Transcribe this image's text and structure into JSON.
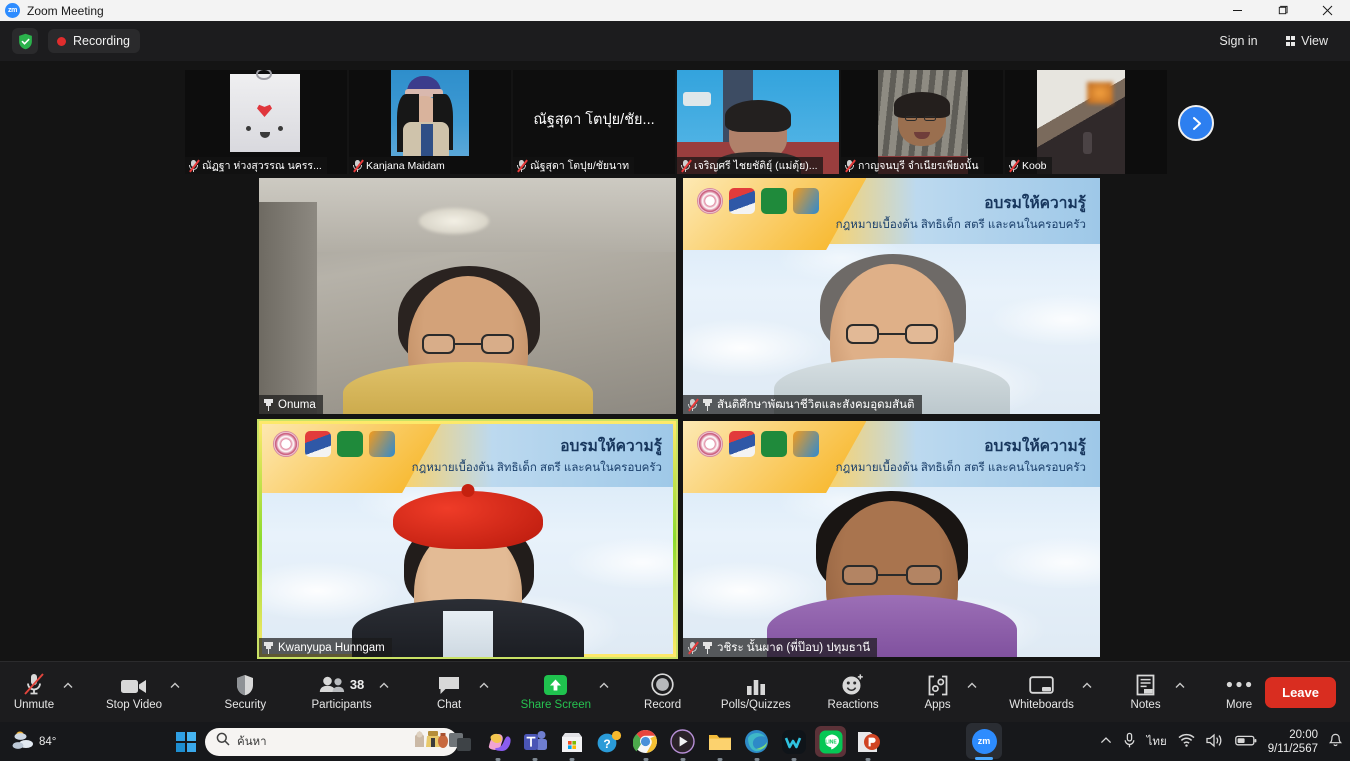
{
  "window": {
    "title": "Zoom Meeting",
    "app_icon": "zoom-logo-icon",
    "minimize_label": "Minimize",
    "maximize_label": "Restore",
    "close_label": "Close"
  },
  "topbar": {
    "encryption_icon": "shield-check-icon",
    "recording_label": "Recording",
    "recording_dot_color": "#e02d2d",
    "sign_in_label": "Sign in",
    "view_label": "View",
    "view_icon": "grid-view-icon"
  },
  "filmstrip": {
    "next_page_icon": "chevron-right-icon",
    "tiles": [
      {
        "name": "ณัฏฐา ห่วงสุวรรณ นครร...",
        "muted": true,
        "kind": "photo-avatar"
      },
      {
        "name": "Kanjana Maidam",
        "muted": true,
        "kind": "photo-avatar"
      },
      {
        "name": "ณัฐสุดา โตปุย/ชัยนาท",
        "muted": true,
        "kind": "name-only",
        "big_name": "ณัฐสุดา  โตปุย/ชัย..."
      },
      {
        "name": "เจริญศรี ไชยชัติยุ์ (แม่ตุ้ย)...",
        "muted": true,
        "kind": "video"
      },
      {
        "name": "กาญจนบุรี จำเนียรเพียงนั้น",
        "muted": true,
        "kind": "video"
      },
      {
        "name": "Koob",
        "muted": true,
        "kind": "video"
      }
    ]
  },
  "gallery": {
    "virtual_bg": {
      "heading": "อบรมให้ความรู้",
      "subheading": "กฎหมายเบื้องต้น สิทธิเด็ก สตรี และคนในครอบครัว"
    },
    "tiles": [
      {
        "name": "Onuma",
        "pinned": true,
        "muted": false,
        "active_speaker": false,
        "background": "room"
      },
      {
        "name": "สันติศึกษาพัฒนาชีวิตและสังคมอุดมสันติ",
        "pinned": true,
        "muted": true,
        "active_speaker": false,
        "background": "virtual"
      },
      {
        "name": "Kwanyupa Hunngam",
        "pinned": true,
        "muted": false,
        "active_speaker": true,
        "background": "virtual"
      },
      {
        "name": "วชิระ นั้นผาด (พี่ป๊อบ) ปทุมธานี",
        "pinned": true,
        "muted": true,
        "active_speaker": false,
        "background": "virtual"
      }
    ]
  },
  "controls": {
    "items": [
      {
        "label": "Unmute",
        "icon": "microphone-muted-icon",
        "caret": true,
        "accent": ""
      },
      {
        "label": "Stop Video",
        "icon": "video-camera-icon",
        "caret": true,
        "accent": ""
      },
      {
        "label": "Security",
        "icon": "shield-icon",
        "caret": false,
        "accent": ""
      },
      {
        "label": "Participants",
        "icon": "people-icon",
        "caret": true,
        "accent": "",
        "count": "38"
      },
      {
        "label": "Chat",
        "icon": "chat-bubble-icon",
        "caret": true,
        "accent": ""
      },
      {
        "label": "Share Screen",
        "icon": "share-screen-up-arrow-icon",
        "caret": true,
        "accent": "#26c250"
      },
      {
        "label": "Record",
        "icon": "record-circle-icon",
        "caret": false,
        "accent": ""
      },
      {
        "label": "Polls/Quizzes",
        "icon": "bar-chart-icon",
        "caret": false,
        "accent": ""
      },
      {
        "label": "Reactions",
        "icon": "smiley-plus-icon",
        "caret": false,
        "accent": ""
      },
      {
        "label": "Apps",
        "icon": "apps-bracket-icon",
        "caret": true,
        "accent": ""
      },
      {
        "label": "Whiteboards",
        "icon": "whiteboard-icon",
        "caret": true,
        "accent": ""
      },
      {
        "label": "Notes",
        "icon": "notes-icon",
        "caret": true,
        "accent": ""
      },
      {
        "label": "More",
        "icon": "ellipsis-icon",
        "caret": false,
        "accent": ""
      }
    ],
    "leave_label": "Leave",
    "leave_color": "#d92d20"
  },
  "taskbar": {
    "weather_temp": "84°",
    "weather_icon": "partly-cloudy-icon",
    "start_icon": "windows-logo-icon",
    "search_placeholder": "ค้นหา",
    "search_icon": "search-icon",
    "search_trailing_icon": "museum-artifacts-icon",
    "apps": [
      {
        "name": "task-view-icon",
        "glyph": ""
      },
      {
        "name": "copilot-icon",
        "glyph": ""
      },
      {
        "name": "microsoft-teams-icon",
        "glyph": "T"
      },
      {
        "name": "microsoft-store-icon",
        "glyph": ""
      },
      {
        "name": "get-help-icon",
        "glyph": "?"
      },
      {
        "name": "google-chrome-icon",
        "glyph": ""
      },
      {
        "name": "media-player-icon",
        "glyph": "▶"
      },
      {
        "name": "file-explorer-icon",
        "glyph": ""
      },
      {
        "name": "microsoft-edge-icon",
        "glyph": ""
      },
      {
        "name": "wondershare-icon",
        "glyph": "W"
      },
      {
        "name": "line-app-icon",
        "glyph": "LINE"
      },
      {
        "name": "powerpoint-icon",
        "glyph": "P"
      }
    ],
    "zoom_task_icon": "zoom-taskbar-icon",
    "tray": {
      "overflow_icon": "chevron-up-icon",
      "mic_icon": "microphone-icon",
      "language": "ไทย",
      "wifi_icon": "wifi-icon",
      "volume_icon": "speaker-icon",
      "battery_icon": "battery-icon",
      "time": "20:00",
      "date": "9/11/2567",
      "notification_icon": "bell-icon"
    }
  }
}
